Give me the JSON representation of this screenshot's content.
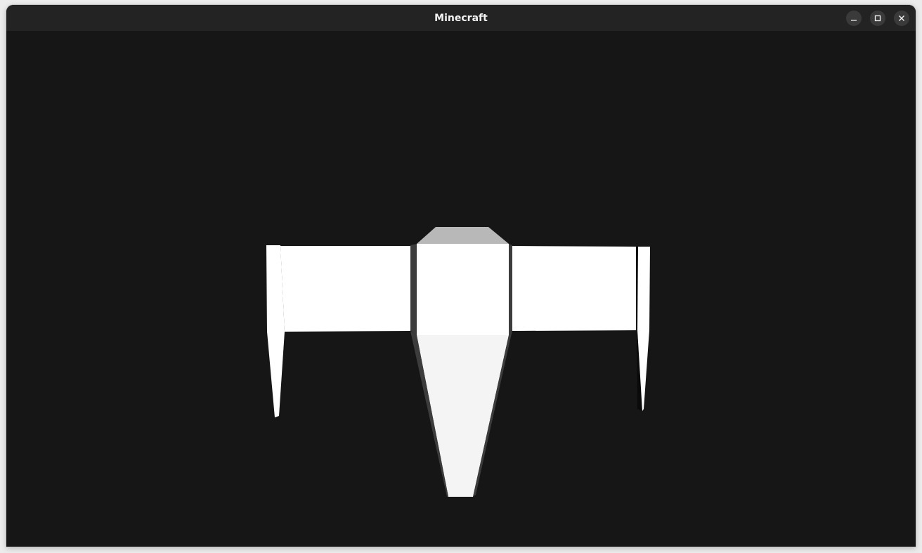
{
  "window": {
    "title": "Minecraft"
  },
  "controls": {
    "minimize_icon": "minimize-icon",
    "maximize_icon": "maximize-icon",
    "close_icon": "close-icon"
  },
  "colors": {
    "viewport_bg": "#161616",
    "titlebar_bg": "#232323",
    "model_light": "#ffffff",
    "model_mid": "#f4f4f4",
    "model_top": "#b8b8b8",
    "model_shadow": "#3c3c3c"
  }
}
